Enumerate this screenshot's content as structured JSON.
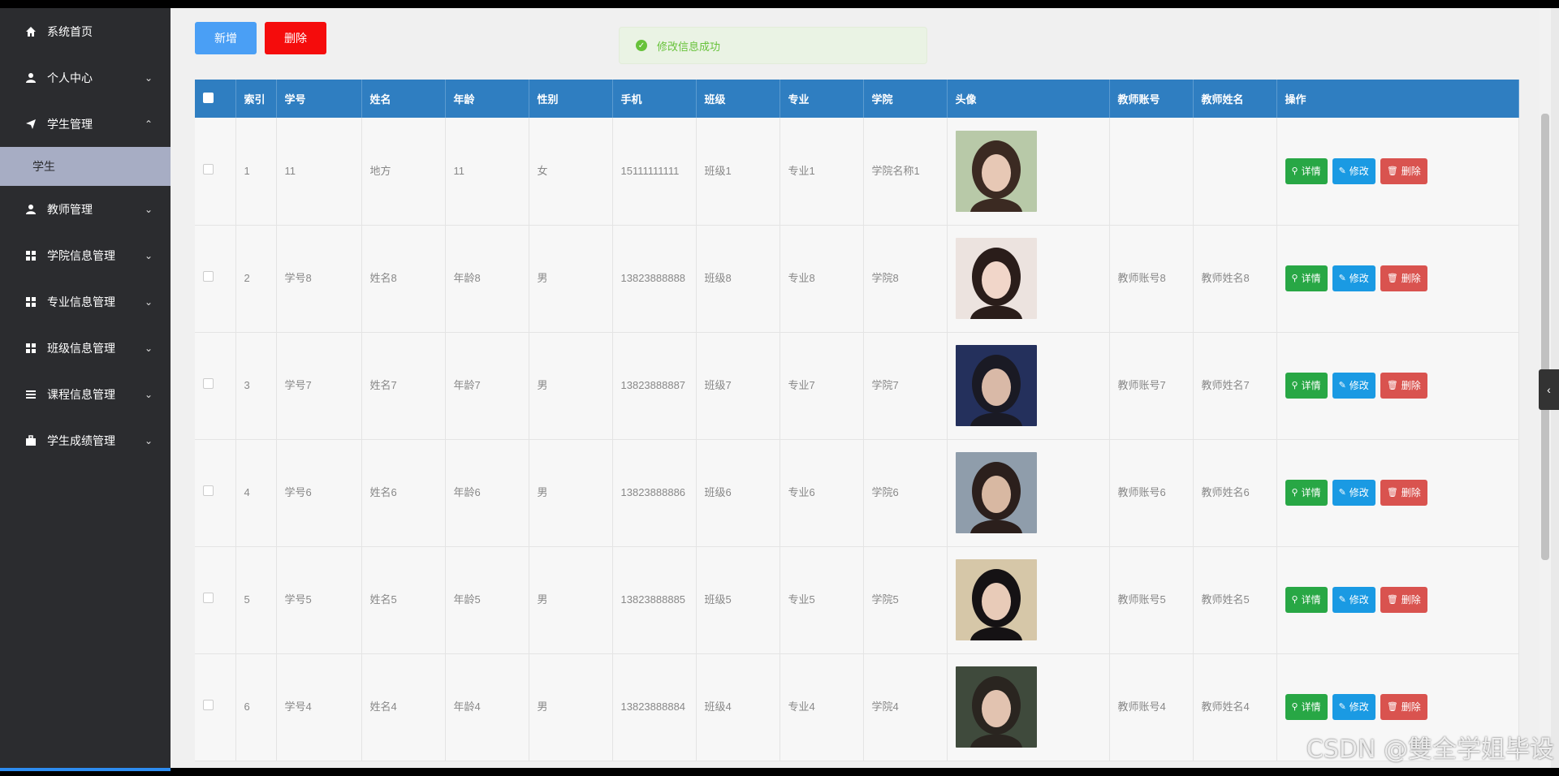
{
  "sidebar": {
    "items": [
      {
        "label": "系统首页",
        "icon": "home-icon"
      },
      {
        "label": "个人中心",
        "icon": "user-icon"
      },
      {
        "label": "学生管理",
        "icon": "paper-plane-icon",
        "expanded": true
      },
      {
        "label": "教师管理",
        "icon": "user-icon"
      },
      {
        "label": "学院信息管理",
        "icon": "grid-icon"
      },
      {
        "label": "专业信息管理",
        "icon": "grid-icon"
      },
      {
        "label": "班级信息管理",
        "icon": "grid-icon"
      },
      {
        "label": "课程信息管理",
        "icon": "list-icon"
      },
      {
        "label": "学生成绩管理",
        "icon": "briefcase-icon"
      }
    ],
    "sub_item": "学生"
  },
  "toolbar": {
    "add_label": "新增",
    "delete_label": "删除"
  },
  "toast": {
    "message": "修改信息成功"
  },
  "table": {
    "headers": [
      "索引",
      "学号",
      "姓名",
      "年龄",
      "性别",
      "手机",
      "班级",
      "专业",
      "学院",
      "头像",
      "教师账号",
      "教师姓名",
      "操作"
    ],
    "rows": [
      {
        "index": "1",
        "id": "11",
        "name": "地方",
        "age": "11",
        "gender": "女",
        "phone": "15111111111",
        "class": "班级1",
        "major": "专业1",
        "college": "学院名称1",
        "teacher_account": "",
        "teacher_name": ""
      },
      {
        "index": "2",
        "id": "学号8",
        "name": "姓名8",
        "age": "年龄8",
        "gender": "男",
        "phone": "13823888888",
        "class": "班级8",
        "major": "专业8",
        "college": "学院8",
        "teacher_account": "教师账号8",
        "teacher_name": "教师姓名8"
      },
      {
        "index": "3",
        "id": "学号7",
        "name": "姓名7",
        "age": "年龄7",
        "gender": "男",
        "phone": "13823888887",
        "class": "班级7",
        "major": "专业7",
        "college": "学院7",
        "teacher_account": "教师账号7",
        "teacher_name": "教师姓名7"
      },
      {
        "index": "4",
        "id": "学号6",
        "name": "姓名6",
        "age": "年龄6",
        "gender": "男",
        "phone": "13823888886",
        "class": "班级6",
        "major": "专业6",
        "college": "学院6",
        "teacher_account": "教师账号6",
        "teacher_name": "教师姓名6"
      },
      {
        "index": "5",
        "id": "学号5",
        "name": "姓名5",
        "age": "年龄5",
        "gender": "男",
        "phone": "13823888885",
        "class": "班级5",
        "major": "专业5",
        "college": "学院5",
        "teacher_account": "教师账号5",
        "teacher_name": "教师姓名5"
      },
      {
        "index": "6",
        "id": "学号4",
        "name": "姓名4",
        "age": "年龄4",
        "gender": "男",
        "phone": "13823888884",
        "class": "班级4",
        "major": "专业4",
        "college": "学院4",
        "teacher_account": "教师账号4",
        "teacher_name": "教师姓名4"
      }
    ],
    "actions": {
      "detail": "详情",
      "edit": "修改",
      "delete": "删除"
    }
  },
  "colors": {
    "sidebar_bg": "#2b2c2f",
    "header_bg": "#2f7ec1",
    "add_button": "#4a9ff5",
    "delete_button": "#f50c0c",
    "detail_button": "#28a745",
    "edit_button": "#1a9ae3",
    "row_delete_button": "#d9534f"
  },
  "watermark": "CSDN @雙全学姐毕设"
}
